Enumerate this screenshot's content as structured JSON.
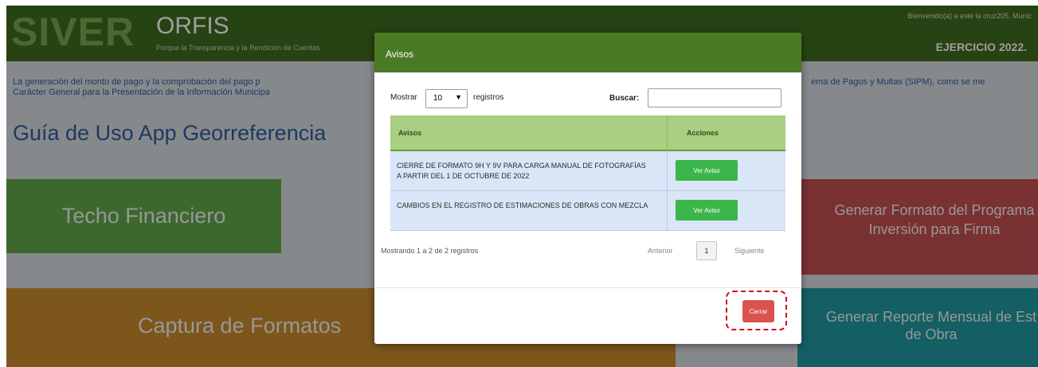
{
  "header": {
    "logo_siver": "SIVER",
    "logo_orfis": "ORFIS",
    "tagline": "Porque la Transparencia y la Rendición de Cuentas",
    "welcome": "Bienvenido(a) a este la cruz205. Munic",
    "ejercicio": "EJERCICIO 2022."
  },
  "notice": {
    "line1": "La generación del monto de pago y la comprobación del pago p",
    "line1_right": "ema de Pagos y Multas (SIPM), como se me",
    "line2": "Carácter General para la Presentación de la Información Municipa"
  },
  "guia_title": "Guía de Uso App Georreferencia",
  "tiles": {
    "techo": "Techo Financiero",
    "captura": "Captura de Formatos",
    "generar_line1": "Generar Formato del Programa",
    "generar_line2": "Inversión para Firma",
    "reporte_line1": "Generar Reporte Mensual de Est",
    "reporte_line2": "de Obra"
  },
  "modal": {
    "title": "Avisos",
    "show_label": "Mostrar",
    "show_value": "10",
    "show_suffix": "registros",
    "search_label": "Buscar:",
    "search_value": "",
    "columns": [
      "Avisos",
      "Acciones"
    ],
    "rows": [
      {
        "text": "CIERRE DE FORMATO 9H Y 9V PARA CARGA MANUAL DE FOTOGRAFÍAS A PARTIR DEL 1 DE OCTUBRE DE 2022",
        "action": "Ver Aviso"
      },
      {
        "text": "CAMBIOS EN EL REGISTRO DE ESTIMACIONES DE OBRAS CON MEZCLA",
        "action": "Ver Aviso"
      }
    ],
    "info": "Mostrando 1 a 2 de 2 registros",
    "prev": "Anterior",
    "page": "1",
    "next": "Siguiente",
    "close_label": "Cerrar"
  },
  "colors": {
    "header_green": "#3f6b1f",
    "modal_header": "#4a7a24",
    "table_header": "#a9cf80",
    "row_bg": "#d8e6f7",
    "ver_button": "#3cb54a",
    "cerrar_button": "#d9534f",
    "highlight": "#d0021b"
  },
  "icons": {
    "select_chevron": "chevron-down-icon"
  }
}
